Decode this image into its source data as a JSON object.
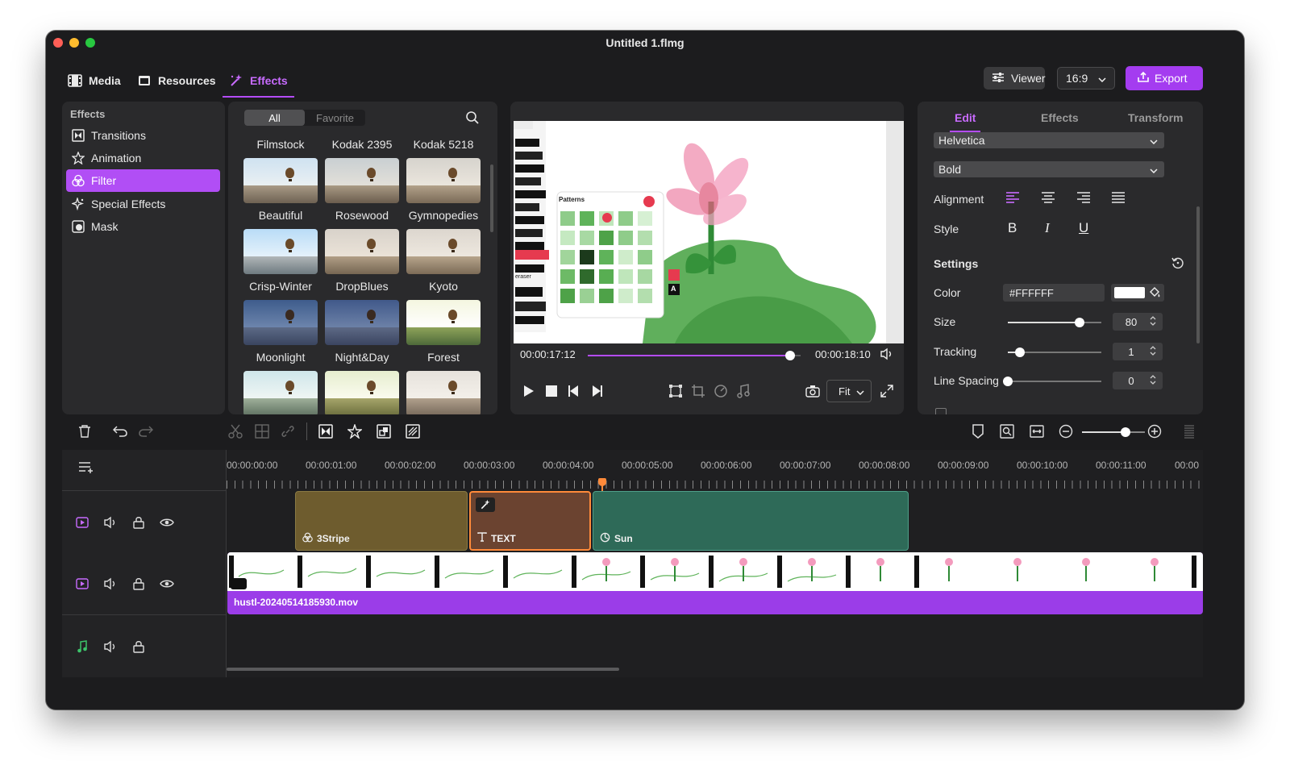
{
  "window": {
    "title": "Untitled 1.flmg"
  },
  "topnav": {
    "tabs": [
      {
        "label": "Media",
        "icon": "film-icon"
      },
      {
        "label": "Resources",
        "icon": "resources-icon"
      },
      {
        "label": "Effects",
        "icon": "magic-wand-icon",
        "active": true
      }
    ],
    "viewer_label": "Viewer",
    "aspect_ratio": "16:9",
    "export_label": "Export"
  },
  "sidebar": {
    "heading": "Effects",
    "items": [
      {
        "label": "Transitions",
        "icon": "transitions-icon"
      },
      {
        "label": "Animation",
        "icon": "animation-star-icon"
      },
      {
        "label": "Filter",
        "icon": "filter-icon",
        "active": true
      },
      {
        "label": "Special Effects",
        "icon": "sparkle-icon"
      },
      {
        "label": "Mask",
        "icon": "mask-icon"
      }
    ]
  },
  "effects_browser": {
    "segments": [
      "All",
      "Favorite"
    ],
    "selected_segment": "All",
    "rows": [
      [
        "Filmstock",
        "Kodak 2395",
        "Kodak 5218"
      ],
      [
        "Beautiful",
        "Rosewood",
        "Gymnopedies"
      ],
      [
        "Crisp-Winter",
        "DropBlues",
        "Kyoto"
      ],
      [
        "Moonlight",
        "Night&Day",
        "Forest"
      ]
    ]
  },
  "preview": {
    "current_time": "00:00:17:12",
    "total_time": "00:00:18:10",
    "progress": 0.95,
    "fit_label": "Fit",
    "overlay": {
      "panel_title": "Patterns",
      "tool_label": "eraser",
      "badge": "A"
    }
  },
  "inspector": {
    "tabs": [
      "Edit",
      "Effects",
      "Transform"
    ],
    "active_tab": "Edit",
    "font": "Helvetica",
    "weight": "Bold",
    "alignment_label": "Alignment",
    "style_label": "Style",
    "style_buttons": [
      "B",
      "I",
      "U"
    ],
    "settings_label": "Settings",
    "color_label": "Color",
    "color_value": "#FFFFFF",
    "size_label": "Size",
    "size_value": "80",
    "size_level": 0.77,
    "tracking_label": "Tracking",
    "tracking_value": "1",
    "tracking_level": 0.13,
    "line_spacing_label": "Line Spacing",
    "line_spacing_value": "0",
    "line_spacing_level": 0.0
  },
  "timeline": {
    "ruler": [
      "00:00:00:00",
      "00:00:01:00",
      "00:00:02:00",
      "00:00:03:00",
      "00:00:04:00",
      "00:00:05:00",
      "00:00:06:00",
      "00:00:07:00",
      "00:00:08:00",
      "00:00:09:00",
      "00:00:10:00",
      "00:00:11:00",
      "00:00"
    ],
    "clips": [
      {
        "label": "3Stripe",
        "icon": "filter-icon",
        "color": "#6e5c2e"
      },
      {
        "label": "TEXT",
        "icon": "text-icon",
        "color": "#6b4330"
      },
      {
        "label": "Sun",
        "icon": "sun-icon",
        "color": "#2e6a58"
      }
    ],
    "video_clip": {
      "label": "hustl-20240514185930.mov",
      "color": "#9b3de8"
    }
  },
  "colors": {
    "accent": "#b44cff",
    "export": "#a43cf0"
  }
}
